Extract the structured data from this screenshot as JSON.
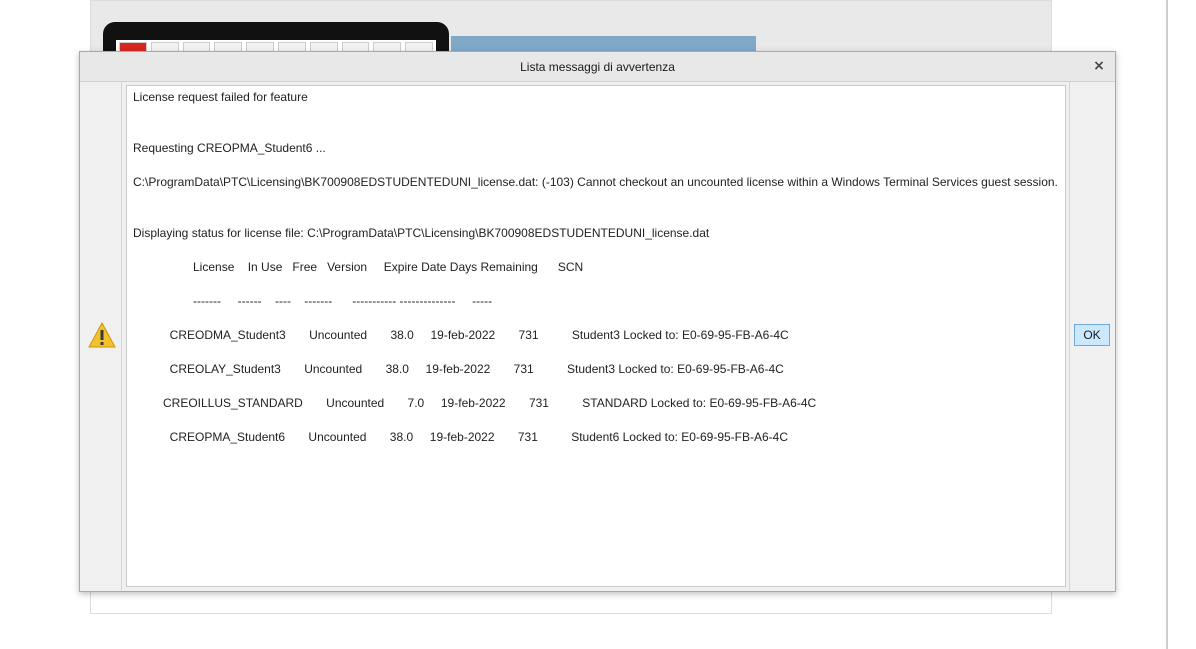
{
  "dialog": {
    "title": "Lista messaggi di avvertenza",
    "close_label": "×",
    "icon": "warning-icon",
    "ok_label": "OK",
    "accent_color": "#cce8ff"
  },
  "message": {
    "lines": [
      "License request failed for feature",
      "",
      "",
      "Requesting CREOPMA_Student6 ...",
      "",
      "C:\\ProgramData\\PTC\\Licensing\\BK700908EDSTUDENTEDUNI_license.dat: (-103) Cannot checkout an uncounted license within a Windows Terminal Services guest session.",
      "",
      "",
      "Displaying status for license file: C:\\ProgramData\\PTC\\Licensing\\BK700908EDSTUDENTEDUNI_license.dat",
      "",
      "                  License    In Use   Free   Version     Expire Date Days Remaining      SCN",
      "",
      "                  -------     ------    ----    -------      ----------- --------------     -----",
      "",
      "           CREODMA_Student3       Uncounted       38.0     19-feb-2022       731          Student3 Locked to: E0-69-95-FB-A6-4C",
      "",
      "           CREOLAY_Student3       Uncounted       38.0     19-feb-2022       731          Student3 Locked to: E0-69-95-FB-A6-4C",
      "",
      "         CREOILLUS_STANDARD       Uncounted       7.0     19-feb-2022       731          STANDARD Locked to: E0-69-95-FB-A6-4C",
      "",
      "           CREOPMA_Student6       Uncounted       38.0     19-feb-2022       731          Student6 Locked to: E0-69-95-FB-A6-4C"
    ]
  }
}
